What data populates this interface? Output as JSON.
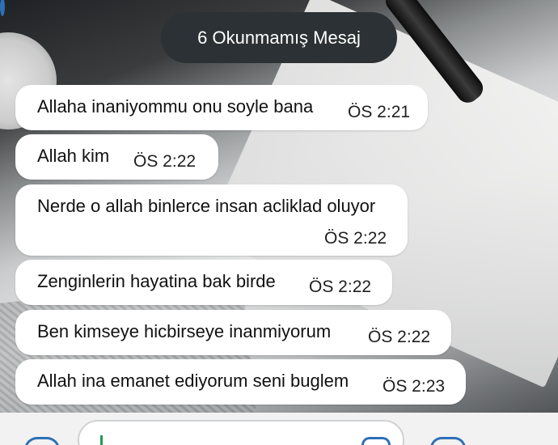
{
  "unread_banner": {
    "label": "6 Okunmamış Mesaj"
  },
  "messages": [
    {
      "text": "Allaha inaniyommu onu soyle bana",
      "time": "ÖS 2:21"
    },
    {
      "text": "Allah kim",
      "time": "ÖS 2:22"
    },
    {
      "text": "Nerde o allah binlerce insan acliklad oluyor",
      "time": "ÖS 2:22"
    },
    {
      "text": "Zenginlerin hayatina bak birde",
      "time": "ÖS 2:22"
    },
    {
      "text": "Ben kimseye hicbirseye inanmiyorum",
      "time": "ÖS 2:22"
    },
    {
      "text": "Allah ina emanet ediyorum seni buglem",
      "time": "ÖS 2:23"
    }
  ],
  "input_bar": {
    "icons": [
      "emoji-icon",
      "sticker-icon",
      "camera-icon",
      "mic-icon"
    ]
  },
  "colors": {
    "banner_bg": "#2b3134",
    "bubble_bg": "#ffffff",
    "accent": "#2e6fb5",
    "cursor": "#1f9b54"
  }
}
